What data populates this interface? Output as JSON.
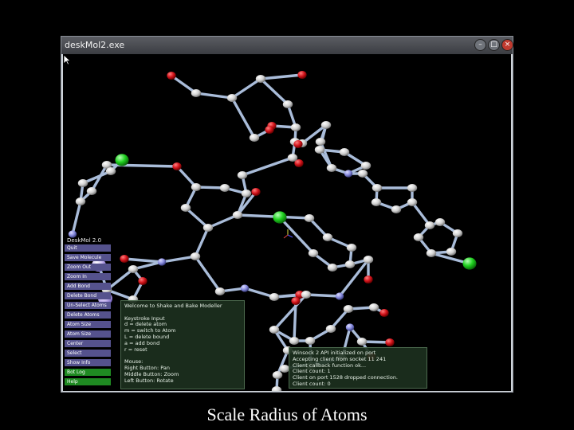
{
  "window": {
    "title": "deskMol2.exe",
    "controls": [
      "minimize",
      "maximize",
      "close"
    ]
  },
  "menu": {
    "title": "DeskMol 2.0",
    "items": [
      {
        "label": "Quit",
        "style": "purple"
      },
      {
        "label": "Save Molecule",
        "style": "purple"
      },
      {
        "label": "Zoom Out",
        "style": "purple"
      },
      {
        "label": "Zoom In",
        "style": "purple"
      },
      {
        "label": "Add Bond",
        "style": "purple"
      },
      {
        "label": "Delete Bond",
        "style": "purple"
      },
      {
        "label": "Un-Select Atoms",
        "style": "purple"
      },
      {
        "label": "Delete Atoms",
        "style": "purple"
      },
      {
        "label": "Atom Size",
        "style": "purple"
      },
      {
        "label": "Atom Size",
        "style": "purple"
      },
      {
        "label": "Center",
        "style": "purple"
      },
      {
        "label": "Select",
        "style": "purple"
      },
      {
        "label": "Show Info",
        "style": "purple"
      },
      {
        "label": "Bot Log",
        "style": "green"
      },
      {
        "label": "Help",
        "style": "green"
      }
    ]
  },
  "help_panel": {
    "lines": [
      "Welcome to Shake and Bake Modeller",
      "",
      "Keystroke Input",
      "d = delete atom",
      "m = switch to Atom",
      "L = delete bound",
      "a = add bond",
      "r = reset",
      "",
      "Mouse:",
      "Right Button: Pan",
      "Middle Button: Zoom",
      "Left Button: Rotate"
    ]
  },
  "console_panel": {
    "lines": [
      "Winsock 2 API initialized on port",
      "Accepting client from socket 11 241",
      "Client callback function ok...",
      "Client count: 1",
      "Client on port 1528 dropped connection.",
      "Client count: 0"
    ]
  },
  "caption": "Scale Radius of Atoms",
  "colors": {
    "carbon": "#d6d6d6",
    "oxygen": "#d4141c",
    "nitrogen": "#8a8ee0",
    "chlorine": "#1fd11f",
    "bond": "#a9bcd9",
    "selected": "#c8b8f0"
  }
}
